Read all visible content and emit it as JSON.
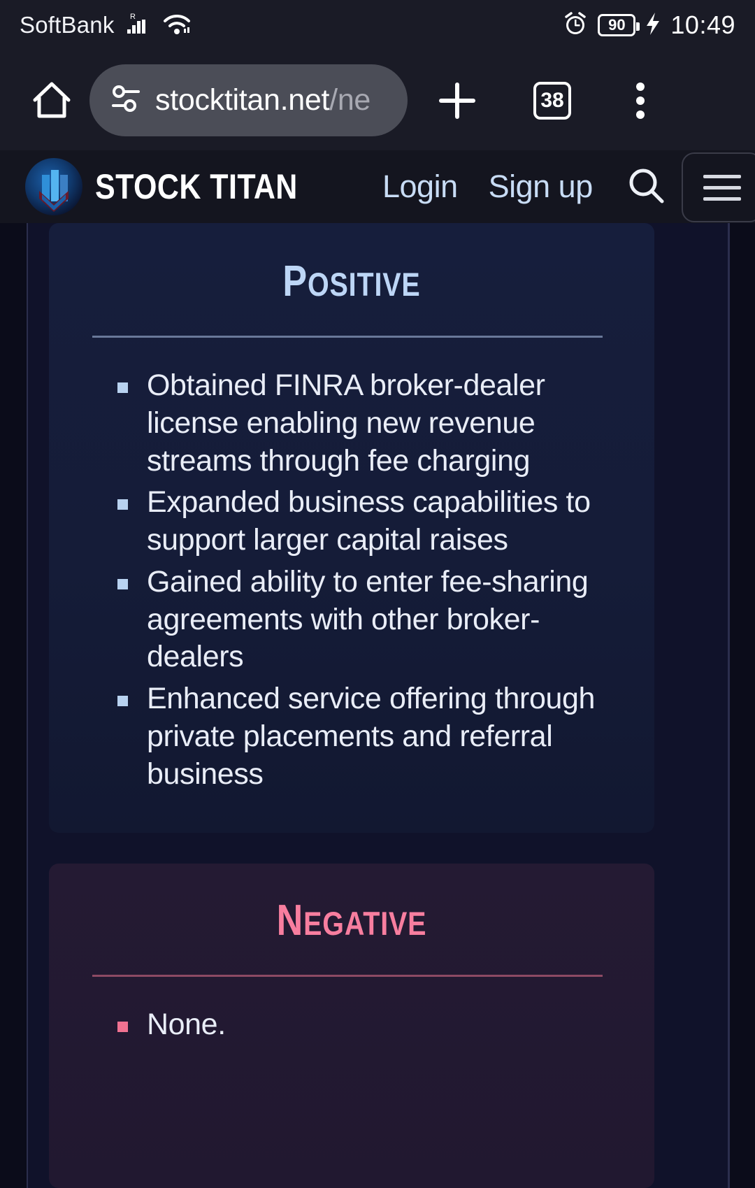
{
  "status_bar": {
    "carrier": "SoftBank",
    "roaming_label": "R",
    "signal_icon": "cellular-signal-icon",
    "wifi_icon": "wifi-icon",
    "alarm_icon": "alarm-clock-icon",
    "battery_level": "90",
    "charging_icon": "charging-bolt-icon",
    "time": "10:49"
  },
  "browser": {
    "home_icon": "home-icon",
    "site_settings_icon": "site-settings-icon",
    "url_host": "stocktitan.net",
    "url_path": "/ne",
    "new_tab_icon": "plus-icon",
    "tab_count": "38",
    "overflow_icon": "more-vertical-icon"
  },
  "site_header": {
    "logo_icon": "stock-titan-logo-icon",
    "brand": "STOCK TITAN",
    "login_label": "Login",
    "signup_label": "Sign up",
    "search_icon": "search-icon",
    "menu_icon": "hamburger-menu-icon"
  },
  "positive_card": {
    "title_first": "P",
    "title_rest": "OSITIVE",
    "accent_color": "#bdd6f6",
    "bullets": [
      "Obtained FINRA broker-dealer license enabling new revenue streams through fee charging",
      "Expanded business capabilities to support larger capital raises",
      "Gained ability to enter fee-sharing agreements with other broker-dealers",
      "Enhanced service offering through private placements and referral business"
    ]
  },
  "negative_card": {
    "title_first": "N",
    "title_rest": "EGATIVE",
    "accent_color": "#f87e9f",
    "bullets": [
      "None."
    ]
  }
}
